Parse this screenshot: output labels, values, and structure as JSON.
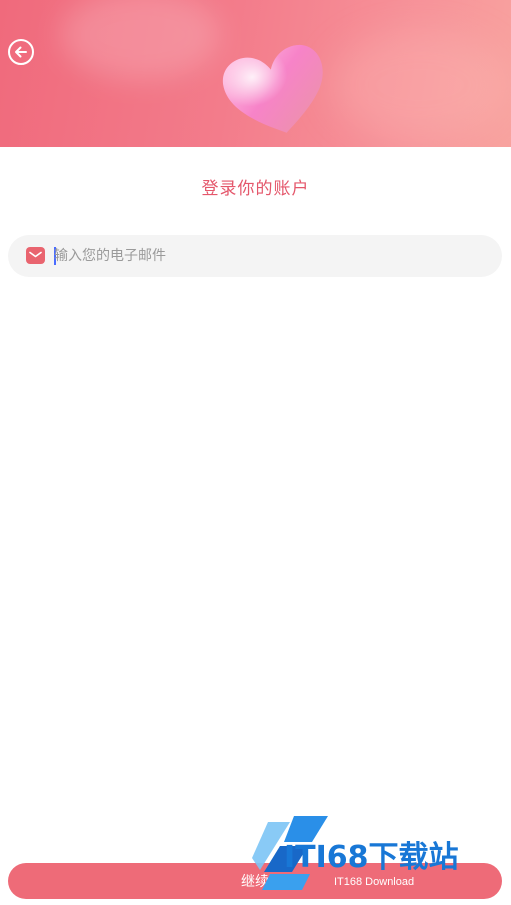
{
  "header": {
    "back_icon": "arrow-left-circle-icon",
    "heart_icon": "heart-3d-icon",
    "gradient_colors": [
      "#f06a7c",
      "#f8a39f"
    ]
  },
  "title": "登录你的账户",
  "email_field": {
    "icon": "mail-icon",
    "placeholder": "输入您的电子邮件",
    "value": ""
  },
  "continue_button": {
    "label": "继续",
    "color": "#ee6b78"
  },
  "watermark": {
    "main": "ITI68下载站",
    "sub": "IT168 Download"
  },
  "colors": {
    "accent": "#e4576b",
    "field_bg": "#f4f4f4"
  }
}
